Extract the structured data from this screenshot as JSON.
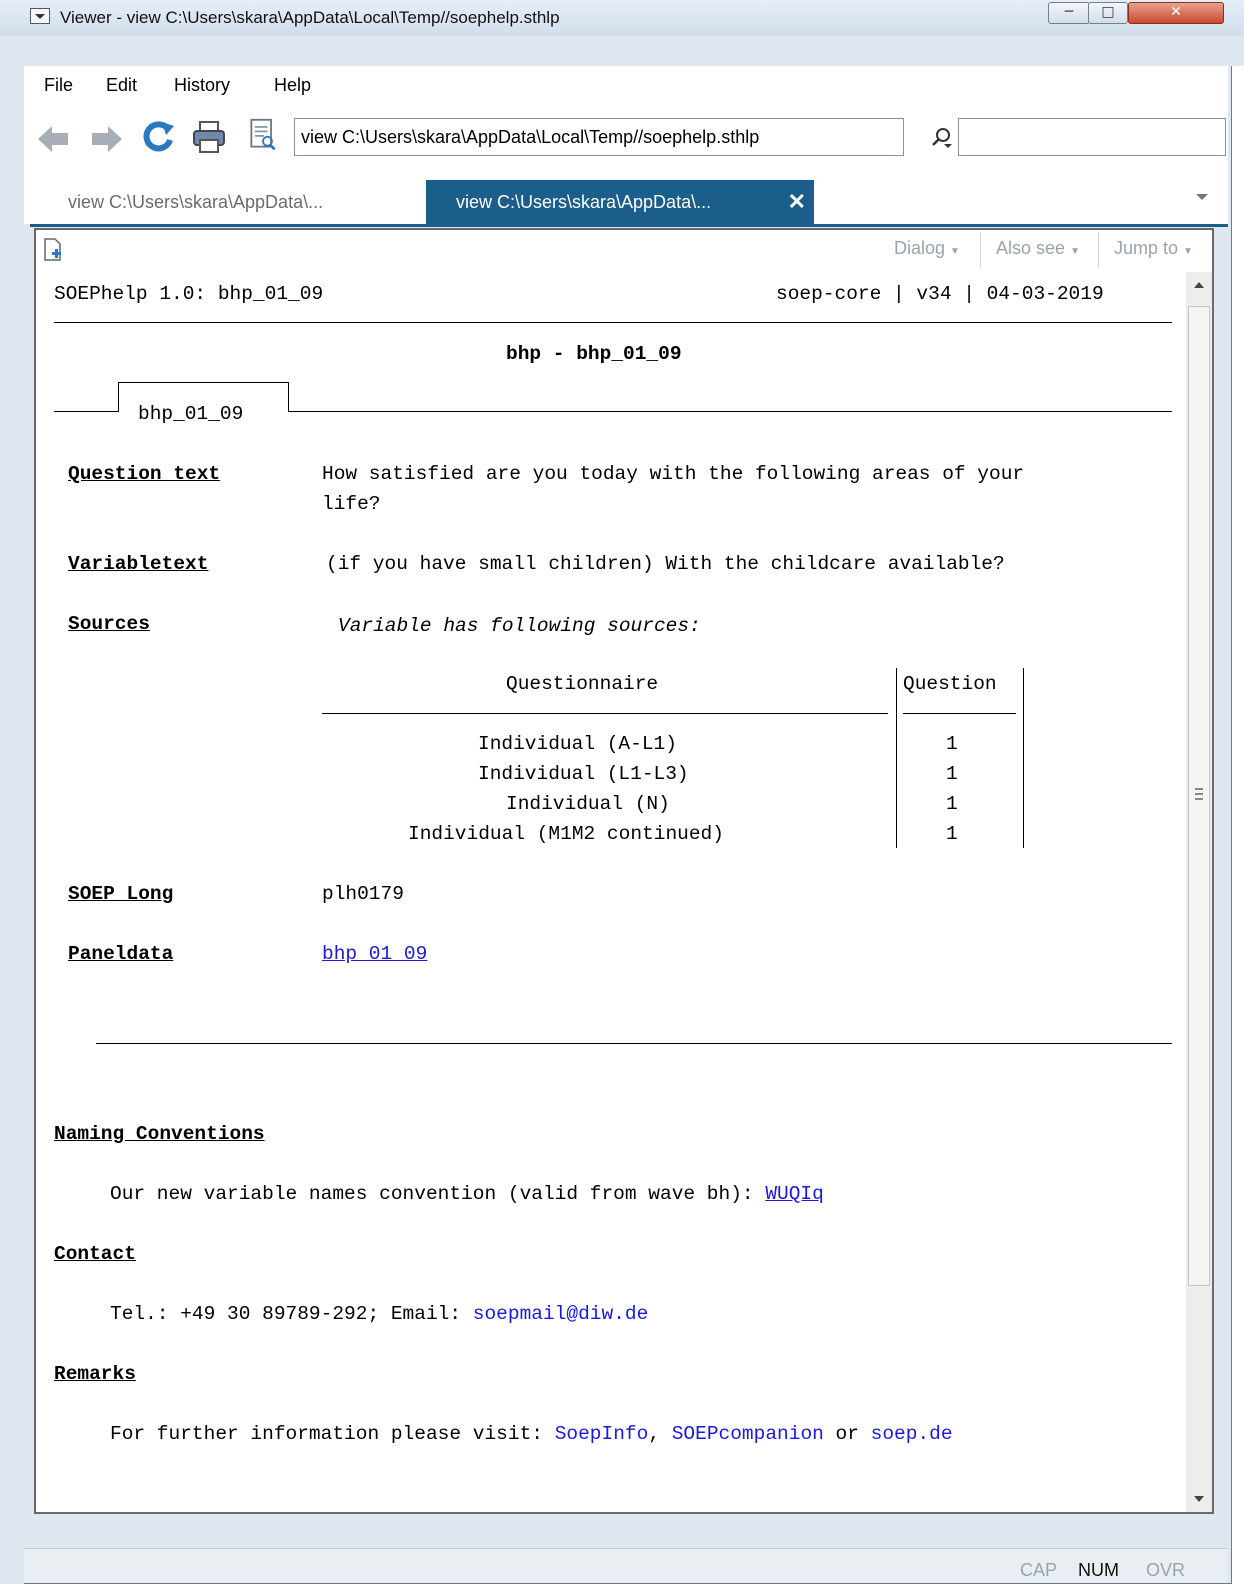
{
  "window": {
    "title": "Viewer - view C:\\Users\\skara\\AppData\\Local\\Temp//soephelp.sthlp"
  },
  "menu": [
    "File",
    "Edit",
    "History",
    "Help"
  ],
  "toolbar": {
    "address": "view C:\\Users\\skara\\AppData\\Local\\Temp//soephelp.sthlp",
    "search_value": ""
  },
  "tabs": [
    {
      "label": "view C:\\Users\\skara\\AppData\\...",
      "active": false
    },
    {
      "label": "view C:\\Users\\skara\\AppData\\...",
      "active": true
    }
  ],
  "viewer_toolbar": {
    "dialog": "Dialog",
    "also_see": "Also see",
    "jump_to": "Jump to"
  },
  "help": {
    "header_left": "SOEPhelp 1.0: bhp_01_09",
    "header_right": "soep-core | v34 | 04-03-2019",
    "title": "bhp - bhp_01_09",
    "tab_label": "bhp_01_09",
    "question_text_label": "Question text",
    "question_text_line1": "How satisfied are you today with the following areas of your",
    "question_text_line2": "life?",
    "variabletext_label": "Variabletext",
    "variabletext": "(if you have small children) With the childcare available?",
    "sources_label": "Sources",
    "sources_intro": "Variable has following sources:",
    "sources_table": {
      "col_questionnaire": "Questionnaire",
      "col_question": "Question",
      "rows": [
        {
          "questionnaire": "Individual (A-L1)",
          "question": "1"
        },
        {
          "questionnaire": "Individual (L1-L3)",
          "question": "1"
        },
        {
          "questionnaire": "Individual (N)",
          "question": "1"
        },
        {
          "questionnaire": "Individual (M1M2 continued)",
          "question": "1"
        }
      ]
    },
    "soep_long_label": "SOEP Long",
    "soep_long_value": "plh0179",
    "paneldata_label": "Paneldata",
    "paneldata_link": "bhp 01 09",
    "naming_label": "Naming Conventions",
    "naming_text": "Our new variable names convention (valid from wave bh): ",
    "naming_link": "WUQIq",
    "contact_label": "Contact",
    "contact_text": "Tel.: +49 30 89789-292; Email: ",
    "contact_email": "soepmail@diw.de",
    "remarks_label": "Remarks",
    "remarks_text": "For further information please visit: ",
    "remarks_link1": "SoepInfo",
    "remarks_sep1": ", ",
    "remarks_link2": "SOEPcompanion",
    "remarks_sep2": " or ",
    "remarks_link3": "soep.de"
  },
  "status": {
    "cap": "CAP",
    "num": "NUM",
    "ovr": "OVR"
  },
  "colors": {
    "tab_active": "#1b5e8c",
    "link": "#1a1adc"
  }
}
